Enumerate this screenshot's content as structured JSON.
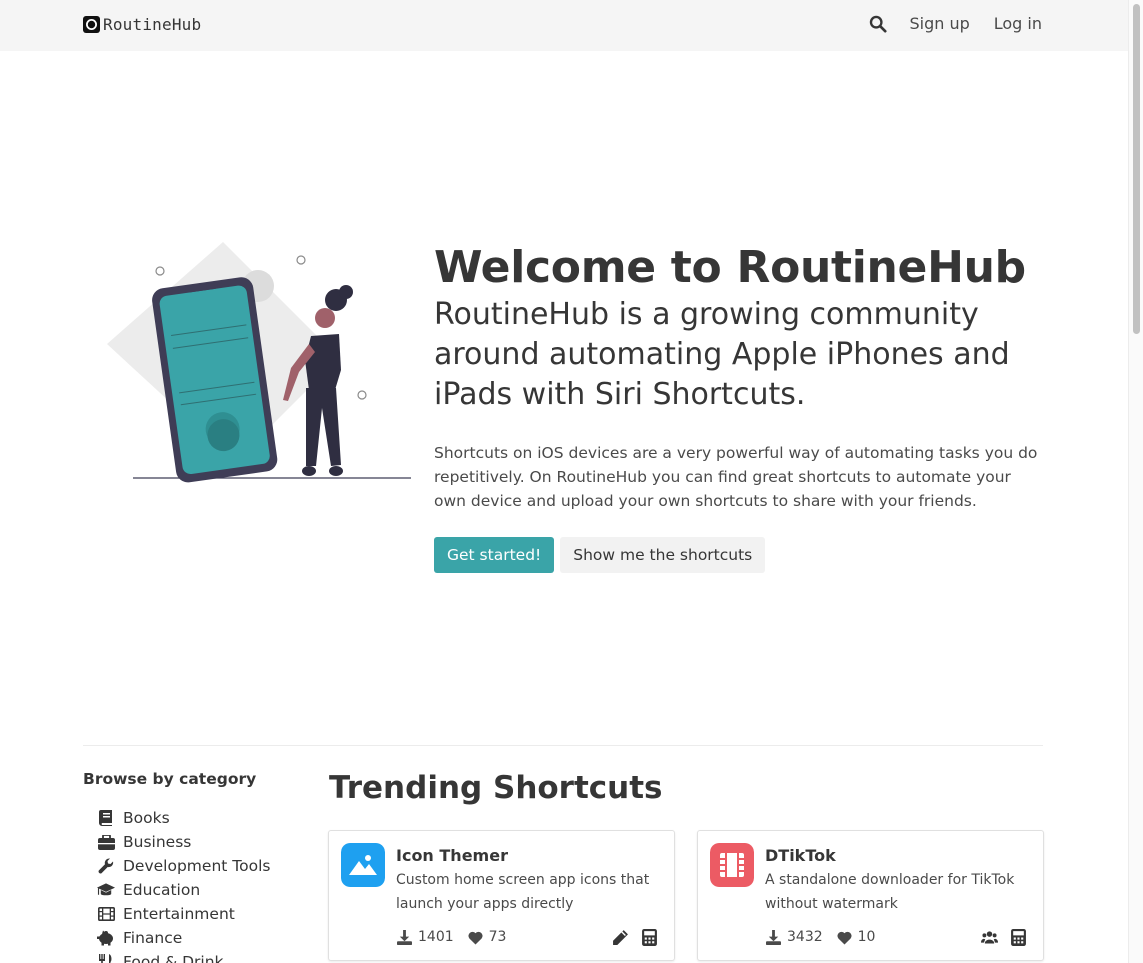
{
  "navbar": {
    "brand": "RoutineHub",
    "signup": "Sign up",
    "login": "Log in"
  },
  "hero": {
    "title": "Welcome to RoutineHub",
    "subtitle": "RoutineHub is a growing community around automating Apple iPhones and iPads with Siri Shortcuts.",
    "description": "Shortcuts on iOS devices are a very powerful way of automating tasks you do repetitively. On RoutineHub you can find great shortcuts to automate your own device and upload your own shortcuts to share with your friends.",
    "primary_button": "Get started!",
    "secondary_button": "Show me the shortcuts"
  },
  "categories": {
    "title": "Browse by category",
    "items": [
      {
        "label": "Books",
        "icon": "book-icon"
      },
      {
        "label": "Business",
        "icon": "briefcase-icon"
      },
      {
        "label": "Development Tools",
        "icon": "wrench-icon"
      },
      {
        "label": "Education",
        "icon": "graduation-cap-icon"
      },
      {
        "label": "Entertainment",
        "icon": "film-icon"
      },
      {
        "label": "Finance",
        "icon": "piggy-bank-icon"
      },
      {
        "label": "Food & Drink",
        "icon": "utensils-icon"
      }
    ]
  },
  "trending": {
    "title": "Trending Shortcuts",
    "cards": [
      {
        "name": "Icon Themer",
        "description": "Custom home screen app icons that launch your apps directly",
        "downloads": "1401",
        "likes": "73",
        "icon_color": "#1ea0f0",
        "icon": "mountain-icon"
      },
      {
        "name": "DTikTok",
        "description": "A standalone downloader for TikTok without watermark",
        "downloads": "3432",
        "likes": "10",
        "icon_color": "#ec5b64",
        "icon": "film-strip-icon"
      }
    ]
  },
  "colors": {
    "accent": "#3aa4a8",
    "navbar_bg": "#f5f5f5",
    "text": "#363636"
  }
}
